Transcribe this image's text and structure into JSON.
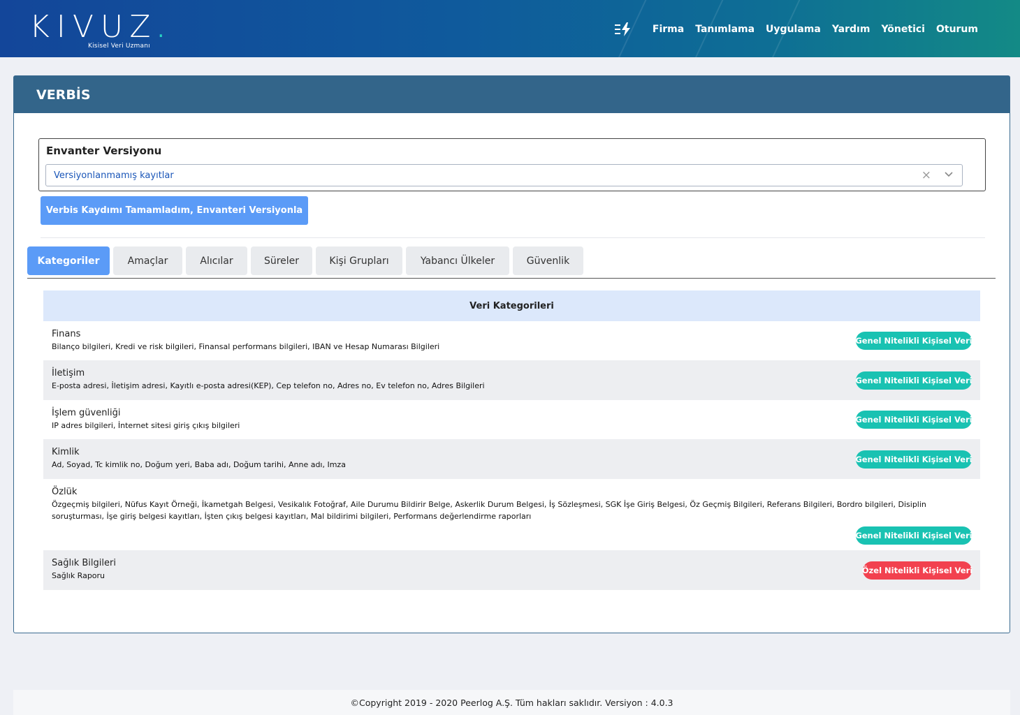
{
  "brand": {
    "name": "KIVUZ",
    "dot": ".",
    "tagline": "Kisisel Veri Uzmanı"
  },
  "nav": {
    "items": [
      "Firma",
      "Tanımlama",
      "Uygulama",
      "Yardım",
      "Yönetici",
      "Oturum"
    ]
  },
  "card": {
    "title": "VERBİS"
  },
  "inventory": {
    "label": "Envanter Versiyonu",
    "selected": "Versiyonlanmamış kayıtlar",
    "clear_glyph": "×"
  },
  "actions": {
    "version_button": "Verbis Kaydımı Tamamladım, Envanteri Versiyonla"
  },
  "tabs": [
    {
      "label": "Kategoriler",
      "active": true
    },
    {
      "label": "Amaçlar",
      "active": false
    },
    {
      "label": "Alıcılar",
      "active": false
    },
    {
      "label": "Süreler",
      "active": false
    },
    {
      "label": "Kişi Grupları",
      "active": false
    },
    {
      "label": "Yabancı Ülkeler",
      "active": false
    },
    {
      "label": "Güvenlik",
      "active": false
    }
  ],
  "table": {
    "header": "Veri Kategorileri",
    "rows": [
      {
        "title": "Finans",
        "desc": "Bilanço bilgileri, Kredi ve risk bilgileri, Finansal performans bilgileri, IBAN ve Hesap Numarası Bilgileri",
        "badge": "Genel Nitelikli Kişisel Veri",
        "type": "general"
      },
      {
        "title": "İletişim",
        "desc": "E-posta adresi, İletişim adresi, Kayıtlı e-posta adresi(KEP), Cep telefon no, Adres no, Ev telefon no, Adres Bilgileri",
        "badge": "Genel Nitelikli Kişisel Veri",
        "type": "general"
      },
      {
        "title": "İşlem güvenliği",
        "desc": "IP adres bilgileri, İnternet sitesi giriş çıkış bilgileri",
        "badge": "Genel Nitelikli Kişisel Veri",
        "type": "general"
      },
      {
        "title": "Kimlik",
        "desc": "Ad, Soyad, Tc kimlik no, Doğum yeri, Baba adı, Doğum tarihi, Anne adı, Imza",
        "badge": "Genel Nitelikli Kişisel Veri",
        "type": "general"
      },
      {
        "title": "Özlük",
        "desc": "Özgeçmiş bilgileri, Nüfus Kayıt Örneği, İkametgah Belgesi, Vesikalık Fotoğraf, Aile Durumu Bildirir Belge, Askerlik Durum Belgesi, İş Sözleşmesi, SGK İşe Giriş Belgesi, Öz Geçmiş Bilgileri, Referans Bilgileri, Bordro bilgileri, Disiplin soruşturması, İşe giriş belgesi kayıtları, İşten çıkış belgesi kayıtları, Mal bildirimi bilgileri, Performans değerlendirme raporları",
        "badge": "Genel Nitelikli Kişisel Veri",
        "type": "general"
      },
      {
        "title": "Sağlık Bilgileri",
        "desc": "Sağlık Raporu",
        "badge": "Özel Nitelikli Kişisel Veri",
        "type": "special"
      }
    ]
  },
  "footer": {
    "text": "©Copyright 2019 - 2020 Peerlog A.Ş. Tüm hakları saklıdır. Versiyon : 4.0.3"
  },
  "colors": {
    "header_bg": "#33658a",
    "primary": "#5b9bf7",
    "badge_general": "#19c2b2",
    "badge_special": "#f2414f"
  }
}
